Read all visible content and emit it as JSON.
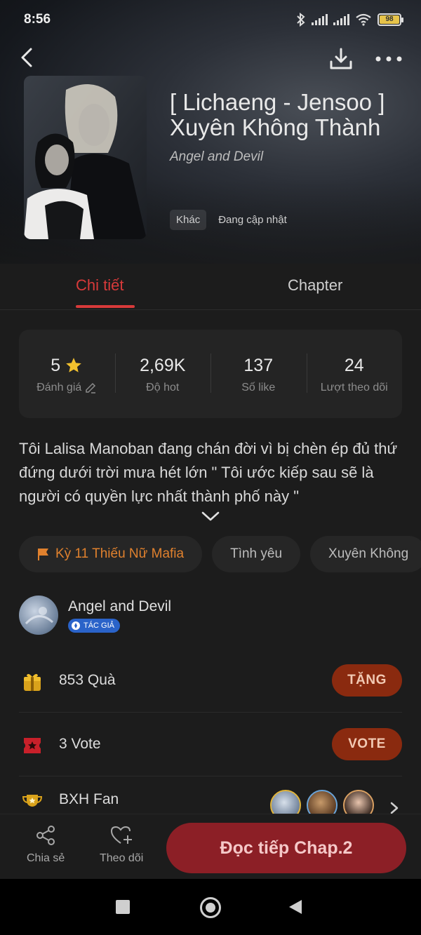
{
  "status": {
    "time": "8:56",
    "battery": "98"
  },
  "story": {
    "title": "[ Lichaeng - Jensoo ] Xuyên Không Thành",
    "author": "Angel and Devil",
    "tags": [
      "Khác",
      "Đang cập nhật"
    ]
  },
  "tabs": {
    "details": "Chi tiết",
    "chapter": "Chapter"
  },
  "stats": [
    {
      "value": "5",
      "label": "Đánh giá"
    },
    {
      "value": "2,69K",
      "label": "Độ hot"
    },
    {
      "value": "137",
      "label": "Số like"
    },
    {
      "value": "24",
      "label": "Lượt theo dõi"
    }
  ],
  "description": "Tôi Lalisa Manoban đang chán đời vì bị chèn ép đủ thứ đứng dưới trời mưa hét lớn \" Tôi ước kiếp sau sẽ là người có quyền lực nhất thành phố này \"",
  "genres": [
    "Kỳ 11 Thiếu Nữ Mafia",
    "Tình yêu",
    "Xuyên Không"
  ],
  "author_block": {
    "name": "Angel and Devil",
    "badge": "TÁC GIẢ"
  },
  "gifts": {
    "label": "853  Quà",
    "button": "TẶNG"
  },
  "votes": {
    "label": "3  Vote",
    "button": "VOTE"
  },
  "fan": {
    "label": "BXH Fan"
  },
  "actions": {
    "share": "Chia sẻ",
    "follow": "Theo dõi",
    "read": "Đọc tiếp Chap.2"
  },
  "colors": {
    "accent": "#d83a3a",
    "orange": "#e0812e",
    "read_button": "#8c1f26",
    "action_button": "#8a2a0f"
  }
}
